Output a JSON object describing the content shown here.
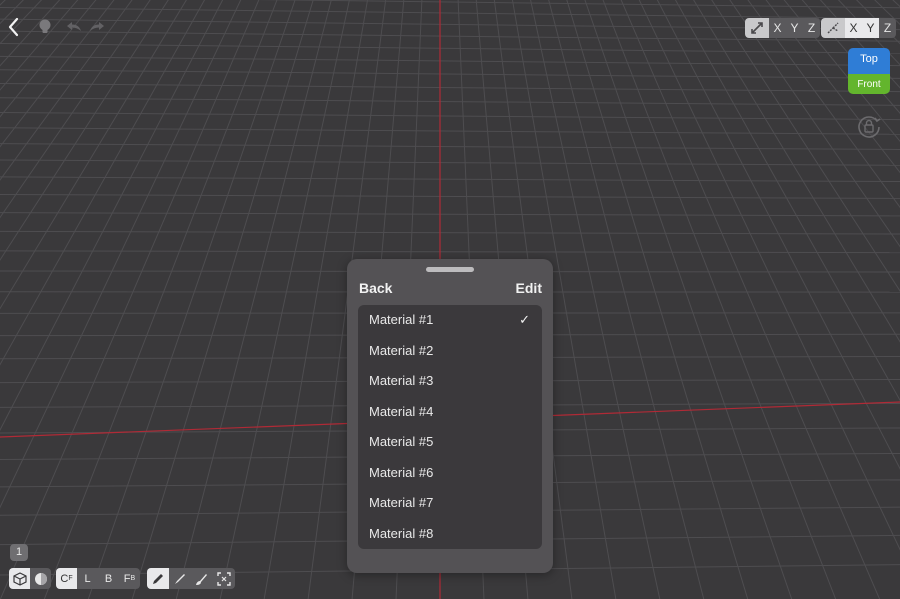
{
  "top_toolbar": {
    "icons": [
      "chevron-left-icon",
      "lightbulb-icon",
      "undo-icon",
      "redo-icon"
    ]
  },
  "axis_lock": {
    "group1": {
      "icon": "move-arrows-icon",
      "axes": [
        "X",
        "Y",
        "Z"
      ]
    },
    "group2": {
      "icon": "rotate-axes-icon",
      "axes": [
        "X",
        "Y",
        "Z"
      ]
    }
  },
  "view_cube": {
    "top_label": "Top",
    "front_label": "Front"
  },
  "orientation_lock": {
    "icon": "rotation-lock-icon"
  },
  "material_panel": {
    "back_label": "Back",
    "edit_label": "Edit",
    "items": [
      {
        "label": "Material #1",
        "selected": true
      },
      {
        "label": "Material #2",
        "selected": false
      },
      {
        "label": "Material #3",
        "selected": false
      },
      {
        "label": "Material #4",
        "selected": false
      },
      {
        "label": "Material #5",
        "selected": false
      },
      {
        "label": "Material #6",
        "selected": false
      },
      {
        "label": "Material #7",
        "selected": false
      },
      {
        "label": "Material #8",
        "selected": false
      }
    ],
    "check_glyph": "✓"
  },
  "bottom_toolbar": {
    "layer_badge": "1",
    "mode_buttons": [
      "cube-icon",
      "sphere-icon"
    ],
    "view_buttons": [
      {
        "label": "C",
        "sub": "F"
      },
      {
        "label": "L",
        "sub": ""
      },
      {
        "label": "B",
        "sub": ""
      },
      {
        "label": "F",
        "sub": "B"
      }
    ],
    "tool_buttons": [
      "pencil-icon",
      "brush-icon",
      "paint-brush-icon",
      "select-frame-icon"
    ]
  },
  "colors": {
    "background": "#3a393b",
    "grid_line": "#4e4d50",
    "axis_red": "#b02a36",
    "panel": "#545255",
    "list": "#3b393c",
    "cube_top": "#2f7dd6",
    "cube_front": "#63b52d"
  }
}
